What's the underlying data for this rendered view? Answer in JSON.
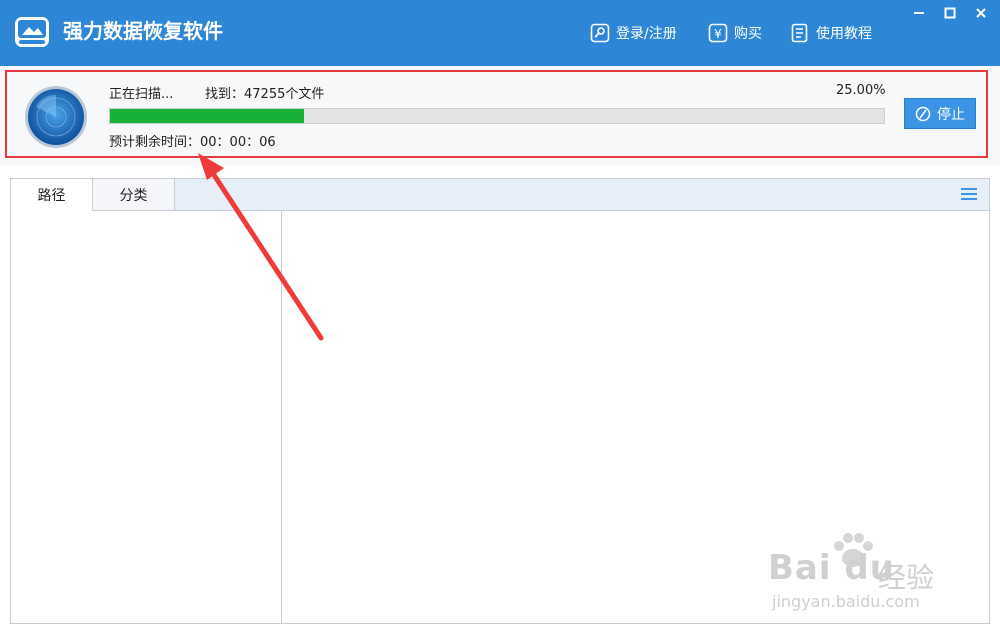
{
  "app": {
    "title": "强力数据恢复软件",
    "accent_color": "#2e87d6"
  },
  "top_nav": {
    "login_label": "登录/注册",
    "buy_label": "购买",
    "buy_icon_glyph": "¥",
    "tutorial_label": "使用教程"
  },
  "window_controls": {
    "minimize": "minimize-icon",
    "maximize": "maximize-icon",
    "close": "close-icon"
  },
  "scan": {
    "status": "正在扫描...",
    "found": "找到：47255个文件",
    "percent_text": "25.00%",
    "progress": 0.25,
    "eta": "预计剩余时间：00：00：06",
    "stop_label": "停止",
    "progress_color": "#17b13a"
  },
  "tabs": [
    {
      "label": "路径",
      "active": true
    },
    {
      "label": "分类",
      "active": false
    }
  ],
  "watermark": {
    "brand": "Bai  du",
    "sub": "经验",
    "url": "jingyan.baidu.com"
  }
}
